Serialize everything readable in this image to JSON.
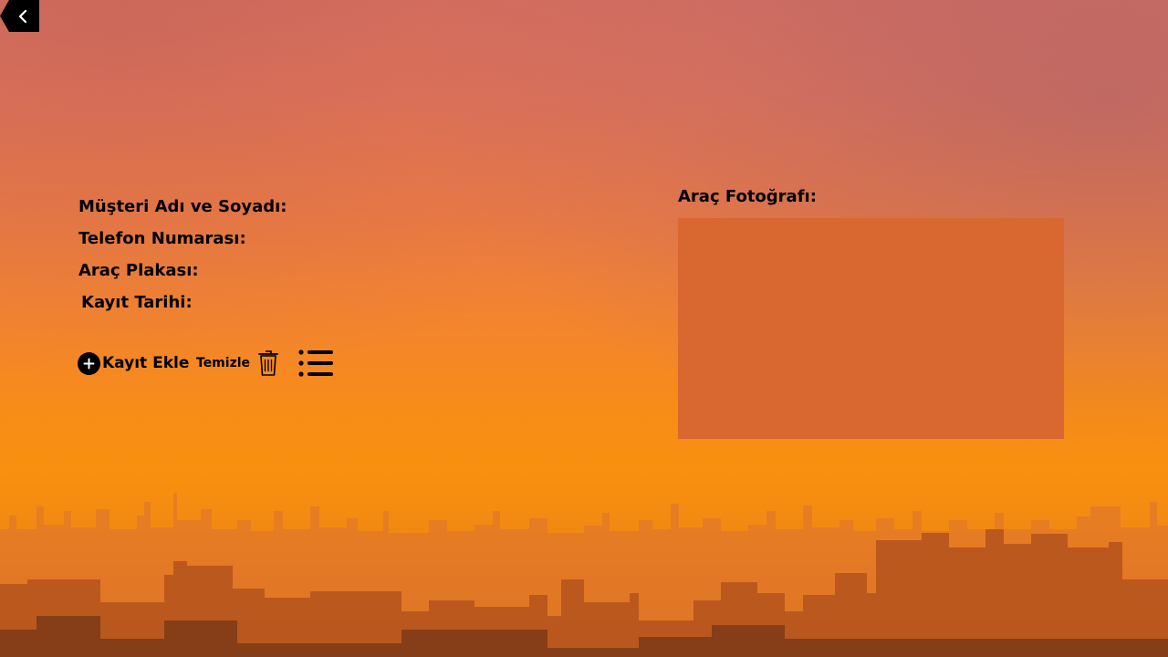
{
  "nav": {
    "back_icon": "chevron-left-icon"
  },
  "form": {
    "name_label": "Müşteri Adı ve Soyadı:",
    "phone_label": "Telefon Numarası:",
    "plate_label": "Araç Plakası:",
    "date_label": "Kayıt Tarihi:"
  },
  "photo": {
    "label": "Araç Fotoğrafı:",
    "background_color": "#d96730"
  },
  "actions": {
    "add_label": "Kayıt Ekle",
    "add_icon": "plus-circle-icon",
    "clear_label": "Temizle",
    "clear_icon": "trash-icon",
    "list_icon": "list-icon"
  },
  "colors": {
    "text": "#000000",
    "sky_top": "#d9705f",
    "sky_bottom": "#f9900f"
  }
}
